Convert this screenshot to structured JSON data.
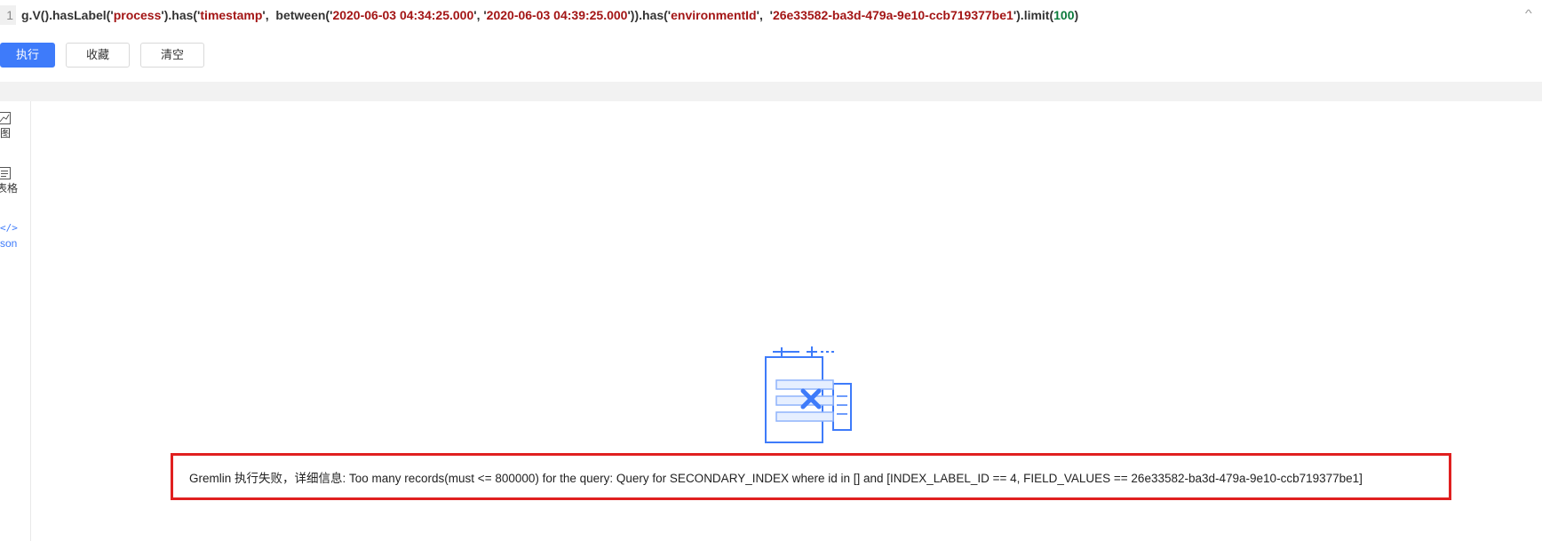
{
  "editor": {
    "line_number": "1",
    "code_parts": [
      {
        "t": "g.V().hasLabel('",
        "c": ""
      },
      {
        "t": "process",
        "c": "s"
      },
      {
        "t": "').has('",
        "c": ""
      },
      {
        "t": "timestamp",
        "c": "s"
      },
      {
        "t": "',  between('",
        "c": ""
      },
      {
        "t": "2020-06-03 04:34:25.000",
        "c": "s"
      },
      {
        "t": "', '",
        "c": ""
      },
      {
        "t": "2020-06-03 04:39:25.000",
        "c": "s"
      },
      {
        "t": "')).has('",
        "c": ""
      },
      {
        "t": "environmentId",
        "c": "s"
      },
      {
        "t": "',  '",
        "c": ""
      },
      {
        "t": "26e33582-ba3d-479a-9e10-ccb719377be1",
        "c": "s"
      },
      {
        "t": "').limit(",
        "c": ""
      },
      {
        "t": "100",
        "c": "n"
      },
      {
        "t": ")",
        "c": ""
      }
    ]
  },
  "toolbar": {
    "execute_label": "执行",
    "favorite_label": "收藏",
    "clear_label": "清空"
  },
  "sidenav": {
    "graph_label": "图",
    "table_label": "表格",
    "json_label": "son"
  },
  "result": {
    "error_message": "Gremlin 执行失败，详细信息: Too many records(must <= 800000) for the query: Query for SECONDARY_INDEX where id in [] and [INDEX_LABEL_ID == 4, FIELD_VALUES == 26e33582-ba3d-479a-9e10-ccb719377be1]"
  },
  "colors": {
    "primary": "#3e7bfa",
    "error_border": "#e02020",
    "string": "#a31515",
    "number": "#0b7a3b"
  }
}
